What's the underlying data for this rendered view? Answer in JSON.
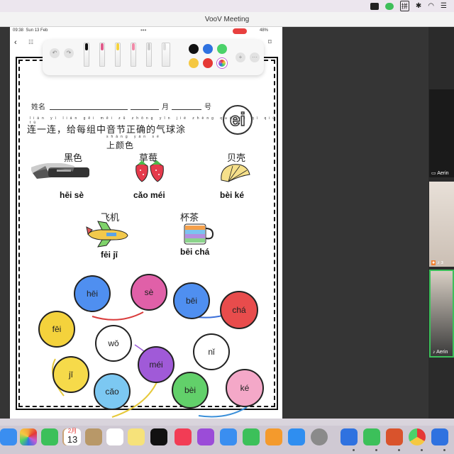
{
  "menubar": {
    "icons": [
      "video-record-icon",
      "line-app-icon",
      "input-method-icon",
      "bluetooth-icon",
      "wifi-icon",
      "control-center-icon"
    ],
    "input_label": "拼"
  },
  "window": {
    "title": "VooV Meeting"
  },
  "ipad": {
    "time": "09:38",
    "date": "Sun 13 Feb",
    "battery": "48%",
    "dots": "•••"
  },
  "toolbar": {
    "undo": "↶",
    "redo": "↷",
    "add": "+",
    "more": "···",
    "colors": [
      "#111111",
      "#2f72e0",
      "#4bd26a",
      "#f5c842",
      "#e53935",
      "#c25bd6"
    ]
  },
  "worksheet": {
    "name_label": "姓名",
    "month_label": "月",
    "day_label": "号",
    "instruction_pinyin": "lián yì lián gěi měi zǔ zhōng yīn jié zhèng què de qì qiú tú",
    "instruction": "连一连，给每组中音节正确的气球涂",
    "instruction_2_pinyin": "shàng yán sè",
    "instruction_2": "上颜色",
    "badge": "ei",
    "words": [
      {
        "cn": "黑色",
        "py": "hēi sè"
      },
      {
        "cn": "草莓",
        "py": "cǎo méi"
      },
      {
        "cn": "贝壳",
        "py": "bèi ké"
      },
      {
        "cn": "飞机",
        "py": "fēi jī"
      },
      {
        "cn": "杯茶",
        "py": "bēi chá"
      }
    ],
    "balloons": [
      "hēi",
      "sè",
      "bēi",
      "chá",
      "fēi",
      "wǒ",
      "nǐ",
      "jī",
      "méi",
      "cǎo",
      "bèi",
      "ké"
    ]
  },
  "participants": [
    {
      "name": "Aerin"
    },
    {
      "name": "з"
    },
    {
      "name": "Aerin"
    }
  ],
  "dock": {
    "calendar_month": "2月",
    "calendar_day": "13"
  }
}
